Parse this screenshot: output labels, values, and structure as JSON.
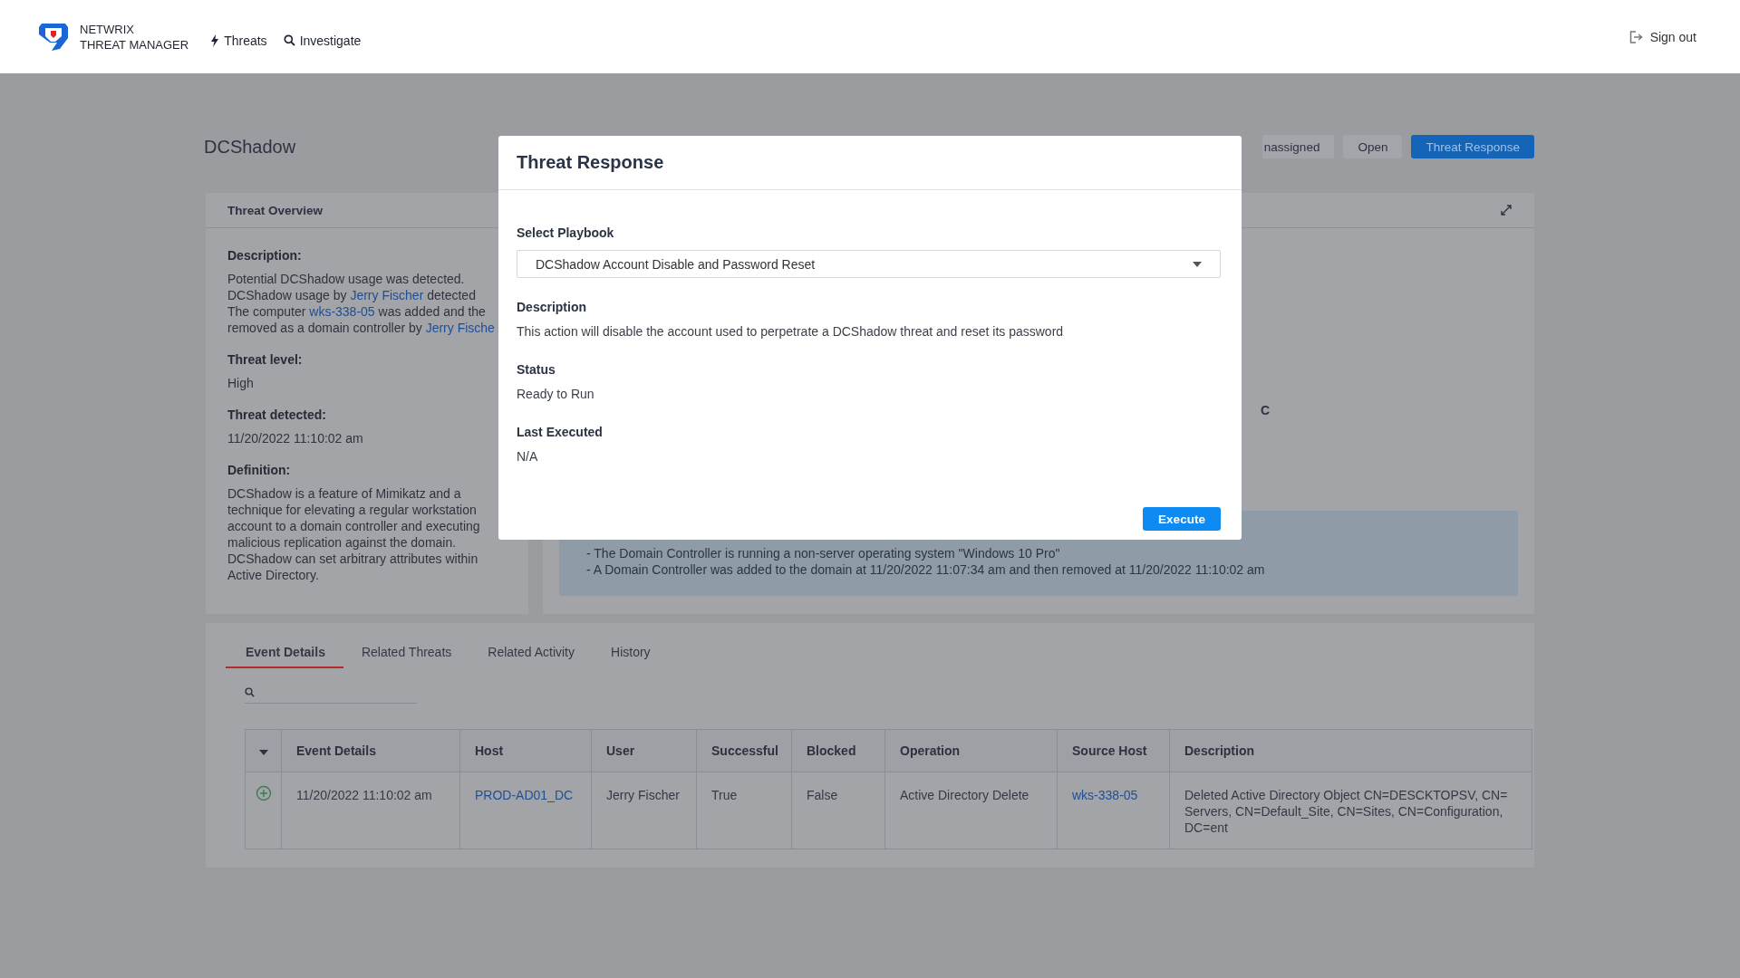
{
  "header": {
    "brand_lines": [
      "NETWRIX",
      "THREAT MANAGER"
    ],
    "nav": [
      {
        "kind": "threats",
        "label": "Threats"
      },
      {
        "kind": "search",
        "label": "Investigate"
      }
    ],
    "sign_out": "Sign out"
  },
  "page": {
    "title": "DCShadow",
    "actions": [
      {
        "label": "nassigned",
        "kind": "plain"
      },
      {
        "label": "Open",
        "kind": "plain"
      },
      {
        "label": "Threat Response",
        "kind": "primary"
      }
    ]
  },
  "overview": {
    "title": "Threat Overview",
    "description_label": "Description:",
    "description_lines": [
      [
        {
          "kind": "text",
          "text": "Potential DCShadow usage was detected."
        }
      ],
      [
        {
          "kind": "text",
          "text": "DCShadow  usage by "
        },
        {
          "kind": "link",
          "text": "Jerry Fischer"
        },
        {
          "kind": "text",
          "text": " detected"
        }
      ],
      [
        {
          "kind": "text",
          "text": "The computer "
        },
        {
          "kind": "link",
          "text": "wks-338-05"
        },
        {
          "kind": "text",
          "text": " was added and the"
        }
      ],
      [
        {
          "kind": "text",
          "text": "removed as a domain controller by "
        },
        {
          "kind": "link",
          "text": "Jerry Fische"
        }
      ]
    ],
    "fields": [
      {
        "label": "Threat level:",
        "value": "High"
      },
      {
        "label": "Threat detected:",
        "value": "11/20/2022 11:10:02 am"
      },
      {
        "label": "Definition:",
        "value": "DCShadow is a feature of Mimikatz and a technique for elevating a regular workstation account to a domain controller and executing malicious replication against the domain. DCShadow can set arbitrary attributes within Active Directory."
      }
    ]
  },
  "details_panel": {
    "partial_heading": "C",
    "alert_lines": [
      "- The Domain Controller is running a non-server operating system \"Windows 10 Pro\"",
      "- A Domain Controller was added to the domain at 11/20/2022 11:07:34 am and then removed at 11/20/2022 11:10:02 am"
    ]
  },
  "tabs": [
    {
      "label": "Event Details",
      "selected": true
    },
    {
      "label": "Related Threats",
      "selected": false
    },
    {
      "label": "Related Activity",
      "selected": false
    },
    {
      "label": "History",
      "selected": false
    }
  ],
  "table": {
    "columns": [
      "Event Details",
      "Host",
      "User",
      "Successful",
      "Blocked",
      "Operation",
      "Source Host",
      "Description"
    ],
    "rows": [
      {
        "expanded": false,
        "cells": [
          {
            "kind": "text",
            "text": "11/20/2022 11:10:02 am"
          },
          {
            "kind": "link",
            "text": "PROD-AD01_DC"
          },
          {
            "kind": "text",
            "text": "Jerry Fischer"
          },
          {
            "kind": "text",
            "text": "True"
          },
          {
            "kind": "text",
            "text": "False"
          },
          {
            "kind": "text",
            "text": "Active Directory Delete"
          },
          {
            "kind": "link",
            "text": "wks-338-05"
          },
          {
            "kind": "text",
            "text": "Deleted Active Directory Object CN=DESCKTOPSV, CN= Servers, CN=Default_Site, CN=Sites, CN=Configuration, DC=ent"
          }
        ]
      }
    ]
  },
  "modal": {
    "title": "Threat Response",
    "playbook_label": "Select Playbook",
    "playbook_value": "DCShadow Account Disable and Password Reset",
    "fields": [
      {
        "label": "Description",
        "value": "This action will disable the account used to perpetrate a DCShadow threat and reset its password"
      },
      {
        "label": "Status",
        "value": "Ready to Run"
      },
      {
        "label": "Last Executed",
        "value": "N/A"
      }
    ],
    "execute": "Execute"
  }
}
